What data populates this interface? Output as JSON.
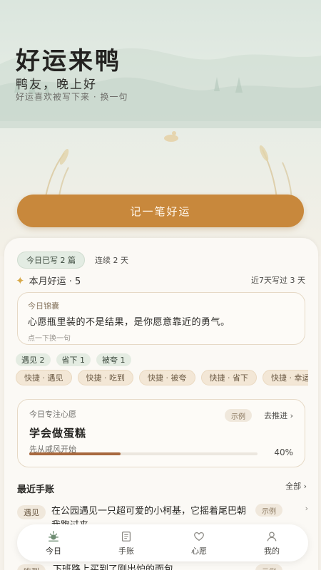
{
  "header": {
    "app_title": "好运来鸭",
    "greeting": "鸭友，晚上好",
    "subtitle": "好运喜欢被写下来",
    "subtitle_sep": " · ",
    "swap_label": "换一句"
  },
  "primary_button": {
    "label": "记一笔好运"
  },
  "stats": {
    "today_written": "今日已写 2 篇",
    "streak": "连续 2 天",
    "month_lucky": "本月好运 · 5",
    "week_stat": "近7天写过 3 天"
  },
  "quote": {
    "label": "今日锦囊",
    "text": "心愿瓶里装的不是结果，是你愿意靠近的勇气。",
    "hint": "点一下换一句"
  },
  "counts": [
    "遇见 2",
    "省下 1",
    "被夸 1"
  ],
  "quick_actions": [
    "快捷 · 遇见",
    "快捷 · 吃到",
    "快捷 · 被夸",
    "快捷 · 省下",
    "快捷 · 幸运"
  ],
  "wish": {
    "label": "今日专注心愿",
    "demo_tag": "示例",
    "push_label": "去推进",
    "title": "学会做蛋糕",
    "subtitle": "先从戚风开始",
    "progress": 0.4,
    "progress_label": "40%"
  },
  "recent": {
    "title": "最近手账",
    "all_label": "全部",
    "entries": [
      {
        "tag": "遇见",
        "text": "在公园遇见一只超可爱的小柯基，它摇着尾巴朝我跑过来",
        "demo_tag": "示例"
      },
      {
        "tag": "吃到",
        "text": "下班路上买到了刚出炉的面包",
        "demo_tag": "示例"
      }
    ]
  },
  "tabs": [
    {
      "label": "今日",
      "icon": "sun-icon",
      "active": true
    },
    {
      "label": "手账",
      "icon": "notebook-icon",
      "active": false
    },
    {
      "label": "心愿",
      "icon": "heart-icon",
      "active": false
    },
    {
      "label": "我的",
      "icon": "person-icon",
      "active": false
    }
  ],
  "colors": {
    "accent": "#c8883c",
    "progress": "#a8693f",
    "background": "#f5f1ea"
  }
}
